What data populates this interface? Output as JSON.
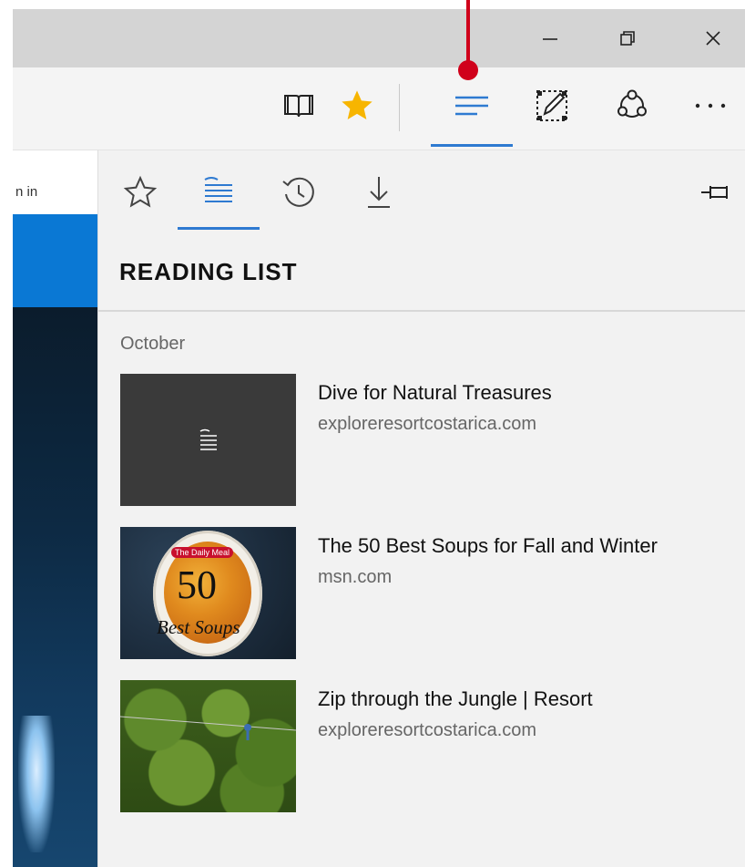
{
  "page": {
    "signin_fragment": "n in"
  },
  "hub": {
    "title": "READING LIST",
    "group_label": "October",
    "items": [
      {
        "title": "Dive for Natural Treasures",
        "domain": "exploreresortcostarica.com",
        "thumbnail": "reading-list-placeholder"
      },
      {
        "title": "The 50 Best Soups for Fall and Winter",
        "domain": "msn.com",
        "thumbnail": "soup-photo",
        "thumb_badge": "The Daily Meal",
        "thumb_number": "50",
        "thumb_caption": "Best Soups"
      },
      {
        "title": "Zip through the Jungle | Resort",
        "domain": "exploreresortcostarica.com",
        "thumbnail": "jungle-photo"
      }
    ]
  },
  "icons": {
    "toolbar": [
      "reading-view-icon",
      "favorite-star-icon",
      "hub-icon",
      "web-note-icon",
      "share-icon",
      "more-icon"
    ],
    "window": [
      "minimize-icon",
      "restore-icon",
      "close-icon"
    ],
    "hub_tabs": [
      "favorites-icon",
      "reading-list-icon",
      "history-icon",
      "downloads-icon"
    ],
    "pin": "pin-icon"
  },
  "colors": {
    "accent": "#2e7ad1",
    "star": "#f7b500",
    "callout": "#d0001b",
    "hub_bg": "#f2f2f2"
  }
}
